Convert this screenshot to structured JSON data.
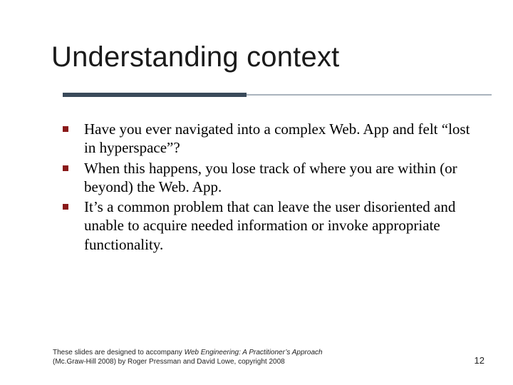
{
  "title": "Understanding context",
  "bullets": [
    "Have you ever navigated into a complex Web. App and felt “lost in hyperspace”?",
    "When this happens, you lose track of where you are within (or beyond) the Web. App.",
    "It’s a common problem that can leave the user disoriented and unable to acquire needed information or invoke appropriate functionality."
  ],
  "footer": {
    "line1_prefix": "These slides are designed to accompany ",
    "line1_italic": "Web Engineering: A Practitioner’s Approach",
    "line2": "(Mc.Graw-Hill 2008) by Roger Pressman and David Lowe, copyright 2008"
  },
  "page_number": "12"
}
